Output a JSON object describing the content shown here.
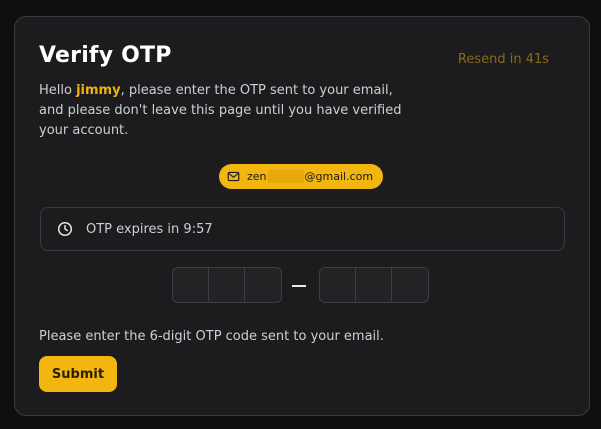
{
  "header": {
    "title": "Verify OTP",
    "resend_label": "Resend in 41s"
  },
  "intro": {
    "greeting": "Hello ",
    "username": "jimmy",
    "message": ", please enter the OTP sent to your email, and please don't leave this page until you have verified your account."
  },
  "email": {
    "prefix": "zen",
    "suffix": "@gmail.com",
    "icon": "mail-icon"
  },
  "expiry": {
    "icon": "clock-icon",
    "label": "OTP expires in 9:57"
  },
  "otp": {
    "group1": [
      "",
      "",
      ""
    ],
    "group2": [
      "",
      "",
      ""
    ]
  },
  "hint": "Please enter the 6-digit OTP code sent to your email.",
  "submit_label": "Submit",
  "colors": {
    "accent": "#f3b50f",
    "background": "#0f0f10",
    "card": "#1c1c1f"
  }
}
